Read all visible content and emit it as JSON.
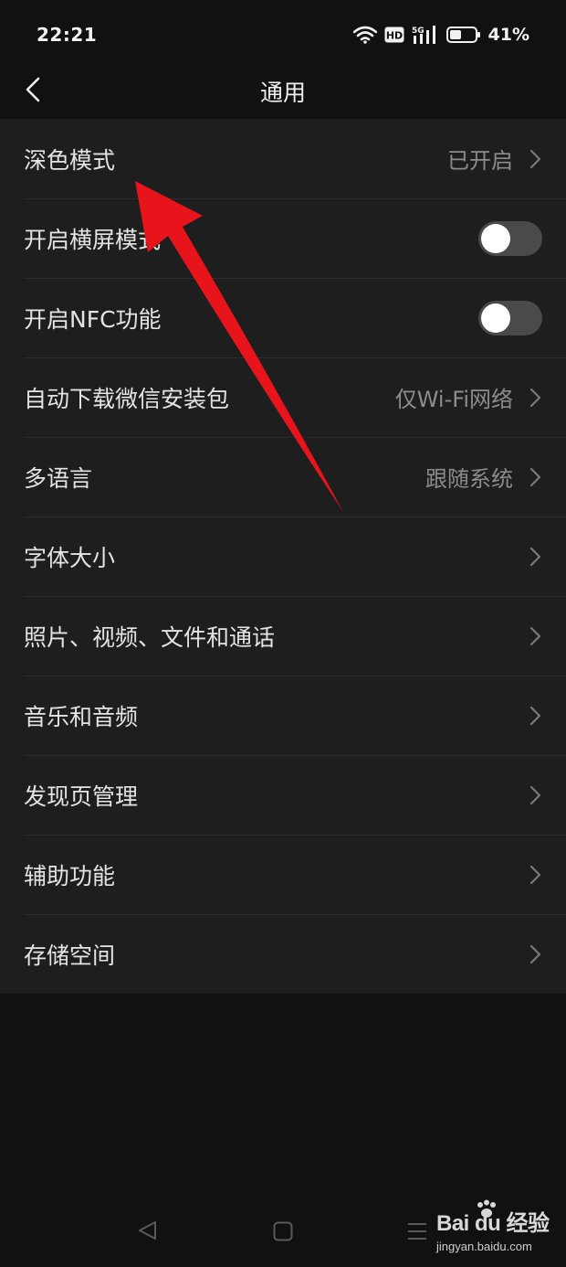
{
  "status_bar": {
    "time": "22:21",
    "hd_label": "HD",
    "network_label": "5G",
    "battery": "41%"
  },
  "header": {
    "title": "通用"
  },
  "settings": [
    {
      "label": "深色模式",
      "value": "已开启",
      "control": "chevron"
    },
    {
      "label": "开启横屏模式",
      "value": "",
      "control": "toggle",
      "toggle_on": false
    },
    {
      "label": "开启NFC功能",
      "value": "",
      "control": "toggle",
      "toggle_on": false
    },
    {
      "label": "自动下载微信安装包",
      "value": "仅Wi-Fi网络",
      "control": "chevron"
    },
    {
      "label": "多语言",
      "value": "跟随系统",
      "control": "chevron"
    },
    {
      "label": "字体大小",
      "value": "",
      "control": "chevron"
    },
    {
      "label": "照片、视频、文件和通话",
      "value": "",
      "control": "chevron"
    },
    {
      "label": "音乐和音频",
      "value": "",
      "control": "chevron"
    },
    {
      "label": "发现页管理",
      "value": "",
      "control": "chevron"
    },
    {
      "label": "辅助功能",
      "value": "",
      "control": "chevron"
    },
    {
      "label": "存储空间",
      "value": "",
      "control": "chevron"
    }
  ],
  "watermark": {
    "main": "Bai du 经验",
    "sub": "jingyan.baidu.com"
  },
  "colors": {
    "background": "#111111",
    "list_background": "#1e1e1e",
    "annotation_arrow": "#e8141c"
  },
  "icons": [
    "back-icon",
    "wifi-icon",
    "signal-icon",
    "battery-icon",
    "chevron-right-icon",
    "annotation-arrow",
    "nav-back-icon",
    "nav-home-icon",
    "nav-menu-icon",
    "baidu-paw-icon"
  ]
}
